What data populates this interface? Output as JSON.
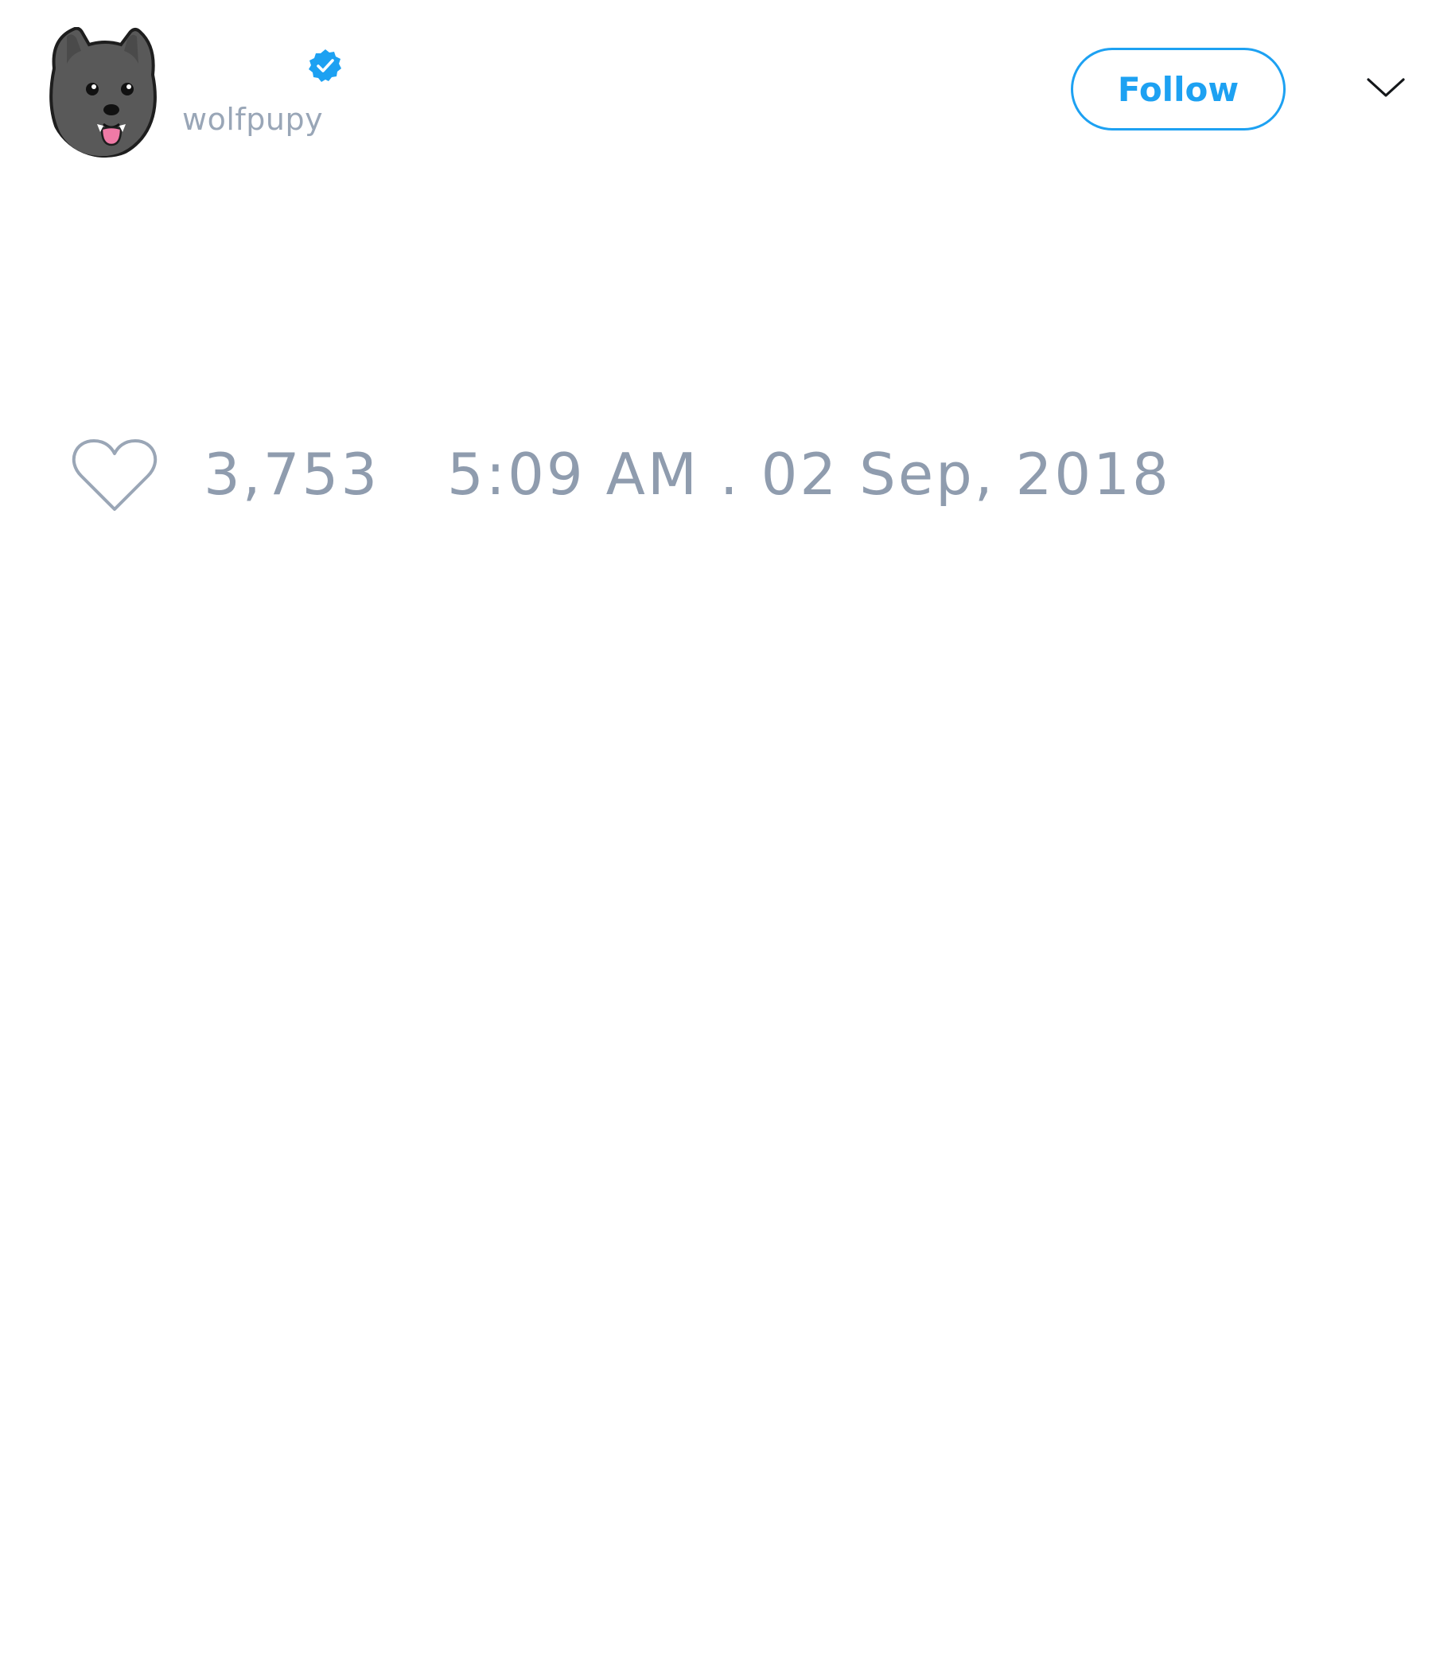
{
  "author": {
    "display_name": "",
    "handle": "wolfpupy",
    "verified": true,
    "avatar_icon": "wolf-puppy-avatar"
  },
  "header": {
    "follow_label": "Follow",
    "menu_icon": "chevron-down-icon"
  },
  "engagement": {
    "like_icon": "heart-outline-icon",
    "like_count": "3,753",
    "timestamp": "5:09 AM . 02 Sep, 2018"
  },
  "colors": {
    "accent": "#1da1f2",
    "muted_text": "#8f9cae",
    "background": "#ffffff"
  }
}
